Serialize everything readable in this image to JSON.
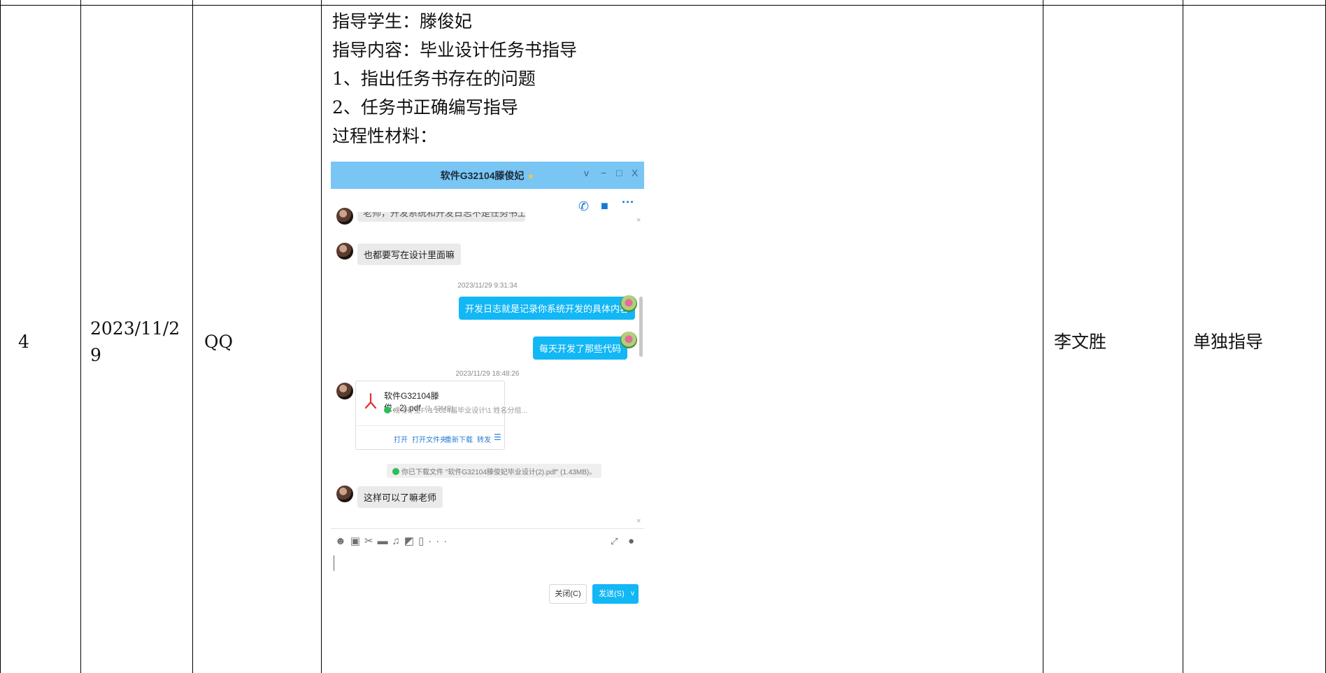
{
  "row": {
    "index": "4",
    "date_line1": "2023/11/2",
    "date_line2": "9",
    "method": "QQ",
    "content_lines": [
      "指导学生：滕俊妃",
      "指导内容：毕业设计任务书指导",
      "1、指出任务书存在的问题",
      "2、任务书正确编写指导",
      "过程性材料："
    ],
    "teacher": "李文胜",
    "type": "单独指导"
  },
  "chat": {
    "title": "软件G32104滕俊妃",
    "window_controls": [
      "v",
      "−",
      "□",
      "X"
    ],
    "toolbar_icons": [
      "phone-icon",
      "video-icon",
      "more-icon"
    ],
    "messages": {
      "cut_top": "老师，开发系统和开发日志不是任务书上的嘛",
      "msg1": "也都要写在设计里面嘛",
      "time1": "2023/11/29 9:31:34",
      "reply1": "开发日志就是记录你系统开发的具体内容",
      "reply2": "每天开发了那些代码",
      "time2": "2023/11/29 18:48:26",
      "notice": "你已下载文件 \"软件G32104滕俊妃毕业设计(2).pdf\" (1.43MB)。",
      "msg2": "这样可以了嘛老师"
    },
    "file": {
      "name": "软件G32104滕俊...2).pdf",
      "size": "(1.43MB)",
      "status": "成功存至F:\\1 2024届毕业设计\\1 姓名分组...",
      "actions": [
        "打开",
        "打开文件夹",
        "重新下载",
        "转发",
        "☰"
      ]
    },
    "input_icons": [
      "emoji-icon",
      "gif-icon",
      "scissors-icon",
      "folder-icon",
      "music-icon",
      "image-icon",
      "phone-screen-icon",
      "more-icon"
    ],
    "close_button": "关闭(C)",
    "send_button": "发送(S)",
    "colors": {
      "titlebar": "#79c6f5",
      "bubble_out": "#12b7f5",
      "bubble_in": "#eaeaea"
    }
  }
}
